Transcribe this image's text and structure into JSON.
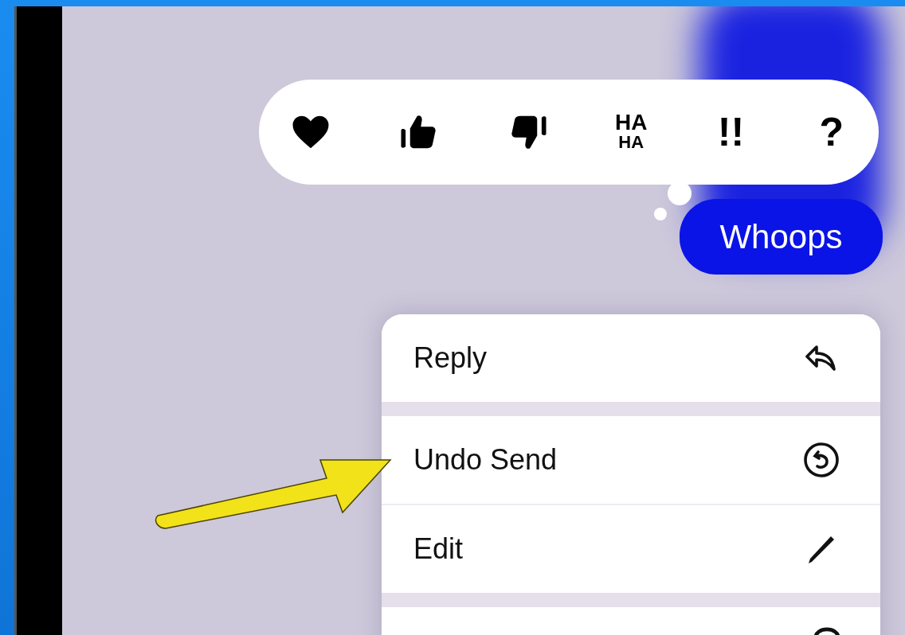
{
  "reactions": [
    {
      "kind": "heart"
    },
    {
      "kind": "thumbs-up"
    },
    {
      "kind": "thumbs-down"
    },
    {
      "kind": "stacked",
      "lines": [
        "HA",
        "HA"
      ]
    },
    {
      "kind": "glyph",
      "label": "!!"
    },
    {
      "kind": "glyph",
      "label": "?"
    }
  ],
  "message": {
    "text": "Whoops"
  },
  "menu": [
    {
      "label": "Reply",
      "kind": "reply",
      "gap_after": true
    },
    {
      "label": "Undo Send",
      "kind": "undo",
      "gap_after": false
    },
    {
      "label": "Edit",
      "kind": "pencil",
      "gap_after": true
    },
    {
      "kind": "cut-off"
    }
  ]
}
